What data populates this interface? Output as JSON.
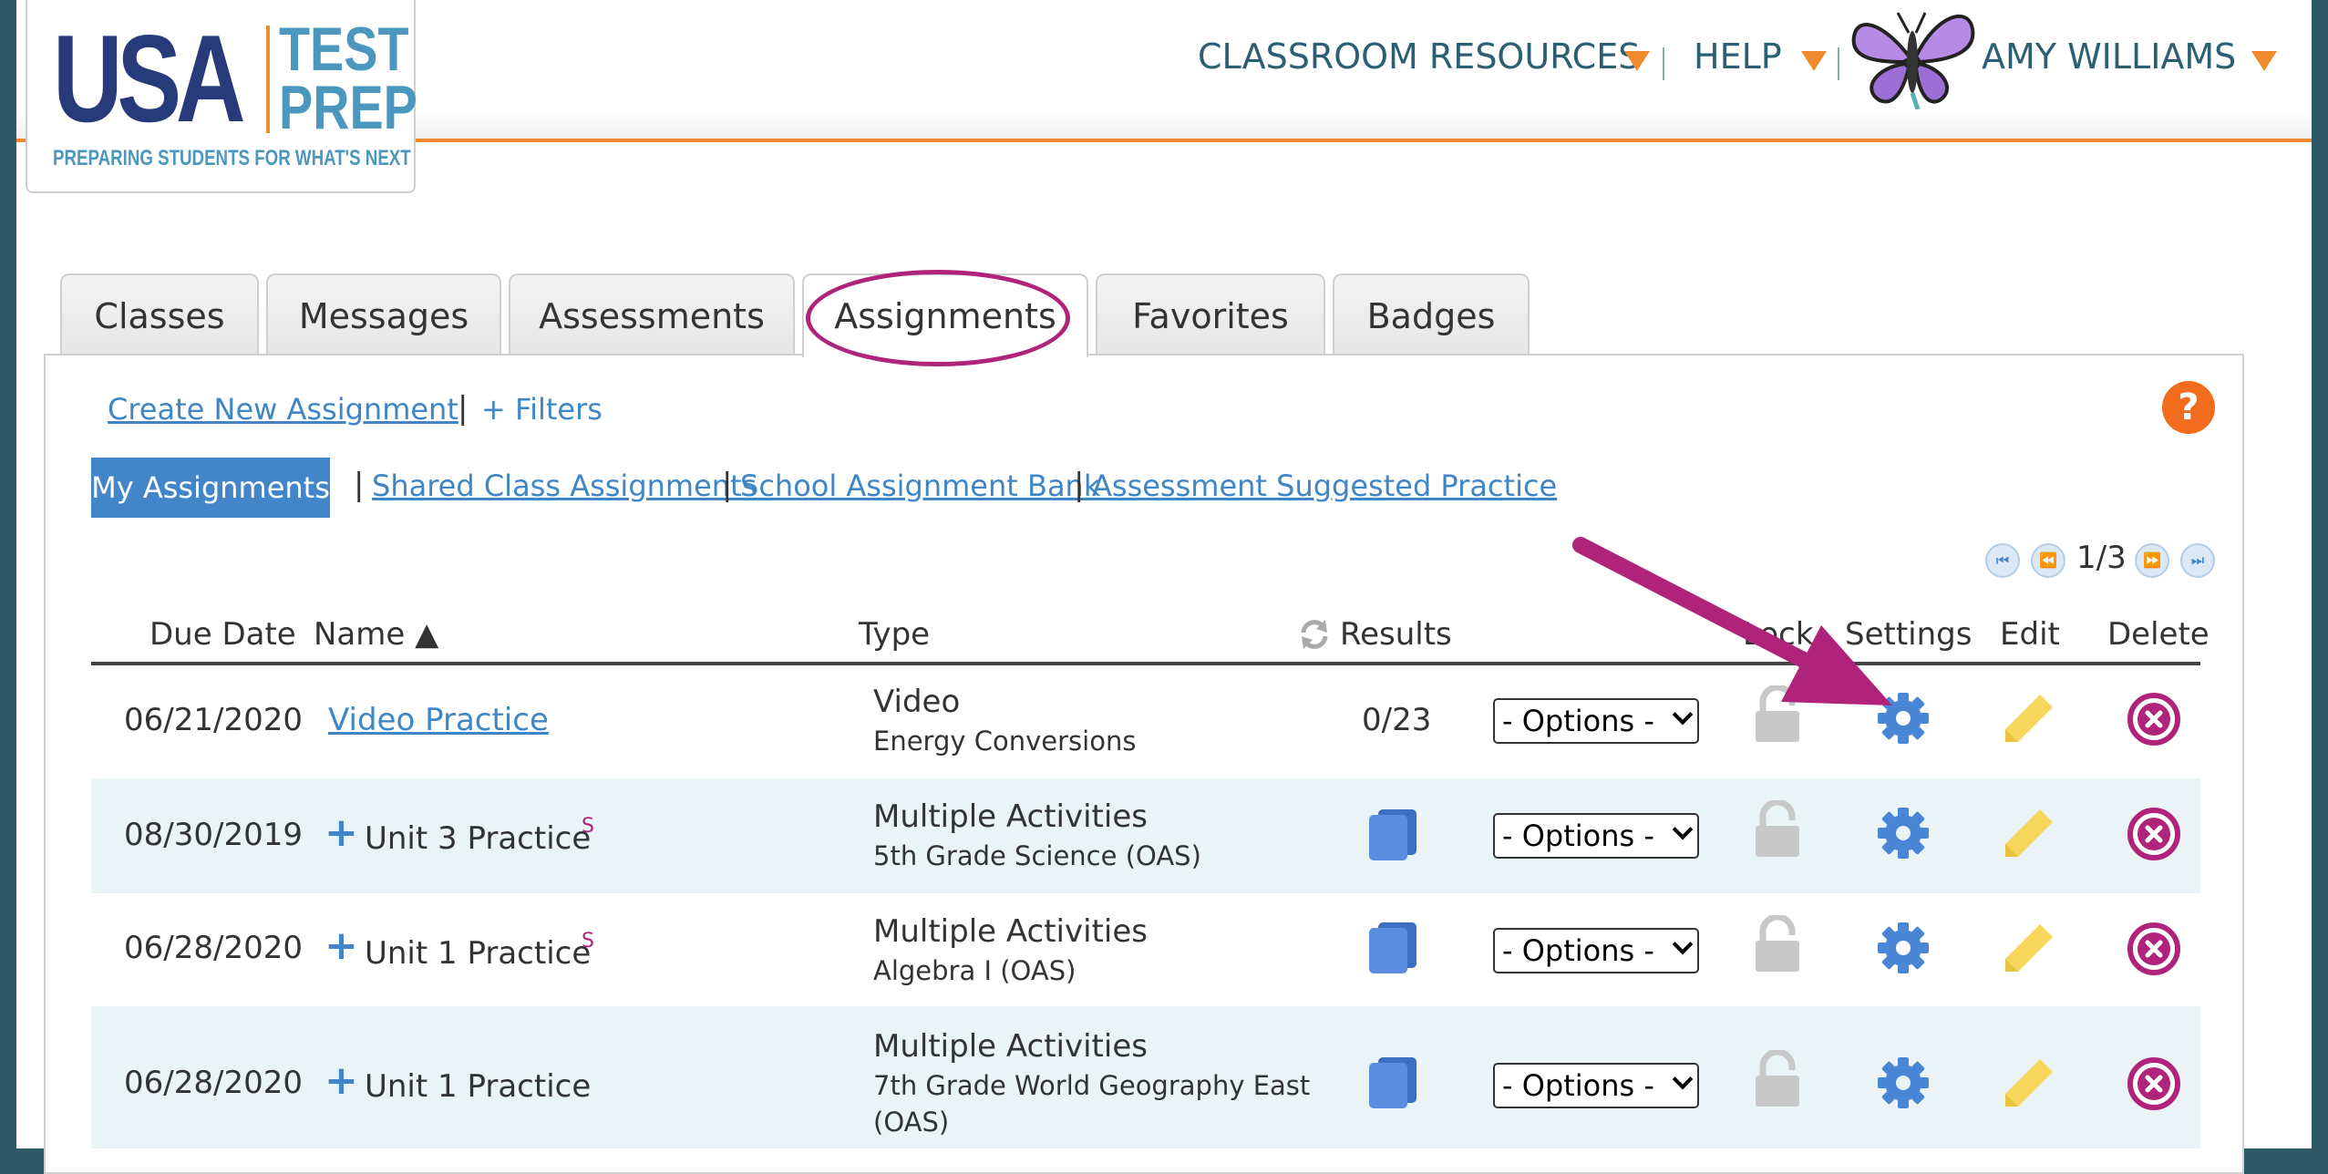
{
  "logo": {
    "line1": "USA",
    "line2a": "TEST",
    "line2b": "PREP",
    "tagline": "PREPARING STUDENTS FOR WHAT'S NEXT"
  },
  "topnav": {
    "resources": "CLASSROOM RESOURCES",
    "help": "HELP",
    "user": "AMY WILLIAMS"
  },
  "tabs": [
    "Classes",
    "Messages",
    "Assessments",
    "Assignments",
    "Favorites",
    "Badges"
  ],
  "active_tab": "Assignments",
  "actions": {
    "create": "Create New Assignment",
    "filters": "+ Filters",
    "pipe": "|"
  },
  "subnav": {
    "active": "My Assignments",
    "items": [
      "Shared Class Assignments",
      "School Assignment Bank",
      "Assessment Suggested Practice"
    ]
  },
  "help_icon": "?",
  "pager": {
    "text": "1/3"
  },
  "columns": {
    "due": "Due Date",
    "name": "Name ▲",
    "type": "Type",
    "results": "Results",
    "lock": "Lock",
    "settings": "Settings",
    "edit": "Edit",
    "delete": "Delete"
  },
  "rows": [
    {
      "due": "06/21/2020",
      "name": "Video Practice",
      "type": "Video",
      "subject": "Energy Conversions",
      "subject2": "",
      "results": "0/23",
      "options": "- Options -",
      "sup": ""
    },
    {
      "due": "08/30/2019",
      "name": "Unit 3 Practice",
      "type": "Multiple Activities",
      "subject": "5th Grade Science (OAS)",
      "subject2": "",
      "results": "",
      "options": "- Options -",
      "sup": "S"
    },
    {
      "due": "06/28/2020",
      "name": "Unit 1 Practice",
      "type": "Multiple Activities",
      "subject": "Algebra I (OAS)",
      "subject2": "",
      "results": "",
      "options": "- Options -",
      "sup": "S"
    },
    {
      "due": "06/28/2020",
      "name": "Unit 1 Practice",
      "type": "Multiple Activities",
      "subject": "7th Grade World Geography East",
      "subject2": "(OAS)",
      "results": "",
      "options": "- Options -",
      "sup": ""
    }
  ],
  "icons": {
    "lock": "lock-icon",
    "settings": "gear-icon",
    "edit": "pencil-icon",
    "delete": "delete-circle-icon",
    "results": "book-icon",
    "refresh": "refresh-icon"
  },
  "colors": {
    "accent_orange": "#f18a2e",
    "link_blue": "#3f86c7",
    "highlight_magenta": "#b0237a",
    "header_text": "#2b5f73"
  }
}
